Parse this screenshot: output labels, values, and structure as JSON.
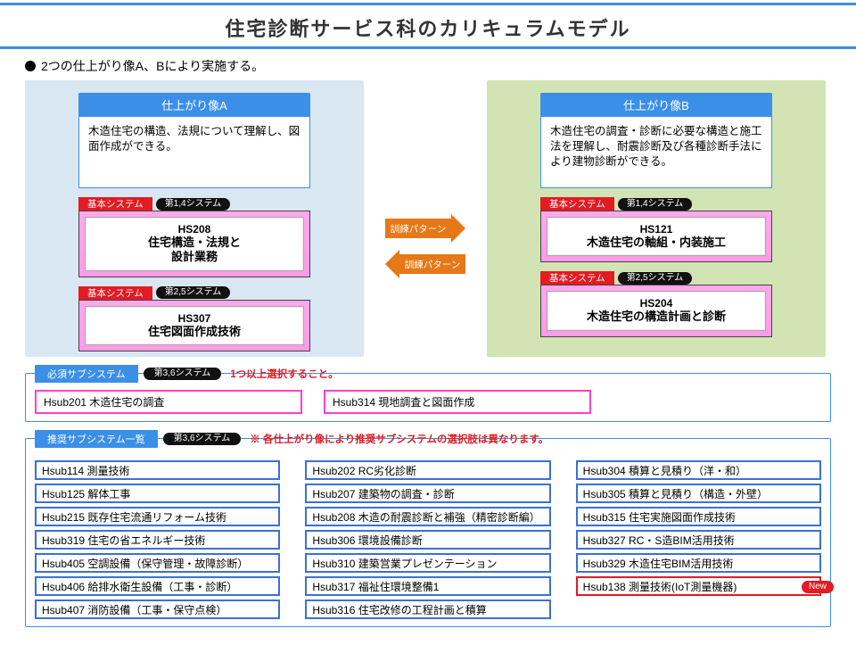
{
  "title": "住宅診断サービス科のカリキュラムモデル",
  "lead": "2つの仕上がり像A、Bにより実施する。",
  "profileA": {
    "head": "仕上がり像A",
    "desc": "木造住宅の構造、法規について理解し、図面作成ができる。",
    "cards": [
      {
        "tab": "基本システム",
        "pill": "第1,4システム",
        "code": "HS208",
        "title": "住宅構造・法規と\n設計業務"
      },
      {
        "tab": "基本システム",
        "pill": "第2,5システム",
        "code": "HS307",
        "title": "住宅図面作成技術"
      }
    ]
  },
  "profileB": {
    "head": "仕上がり像B",
    "desc": "木造住宅の調査・診断に必要な構造と施工法を理解し、耐震診断及び各種診断手法により建物診断ができる。",
    "cards": [
      {
        "tab": "基本システム",
        "pill": "第1,4システム",
        "code": "HS121",
        "title": "木造住宅の軸組・内装施工"
      },
      {
        "tab": "基本システム",
        "pill": "第2,5システム",
        "code": "HS204",
        "title": "木造住宅の構造計画と診断"
      }
    ]
  },
  "arrow_label": "訓練パターン",
  "required": {
    "label": "必須サブシステム",
    "pill": "第3,6システム",
    "note": "1つ以上選択すること。",
    "items": [
      "Hsub201  木造住宅の調査",
      "Hsub314  現地調査と図面作成"
    ]
  },
  "recommended": {
    "label": "推奨サブシステム一覧",
    "pill": "第3,6システム",
    "note": "※ 各仕上がり像により推奨サブシステムの選択肢は異なります。",
    "col1": [
      "Hsub114  測量技術",
      "Hsub125  解体工事",
      "Hsub215  既存住宅流通リフォーム技術",
      "Hsub319  住宅の省エネルギー技術",
      "Hsub405  空調設備（保守管理・故障診断）",
      "Hsub406  給排水衛生設備（工事・診断）",
      "Hsub407  消防設備（工事・保守点検）"
    ],
    "col2": [
      "Hsub202  RC劣化診断",
      "Hsub207  建築物の調査・診断",
      "Hsub208  木造の耐震診断と補強（精密診断編）",
      "Hsub306  環境設備診断",
      "Hsub310  建築営業プレゼンテーション",
      "Hsub317  福祉住環境整備1",
      "Hsub316  住宅改修の工程計画と積算"
    ],
    "col3": [
      "Hsub304  積算と見積り（洋・和）",
      "Hsub305  積算と見積り（構造・外壁）",
      "Hsub315  住宅実施図面作成技術",
      "Hsub327  RC・S造BIM活用技術",
      "Hsub329  木造住宅BIM活用技術"
    ],
    "col3_red": "Hsub138  測量技術(IoT測量機器)",
    "new_label": "New"
  }
}
